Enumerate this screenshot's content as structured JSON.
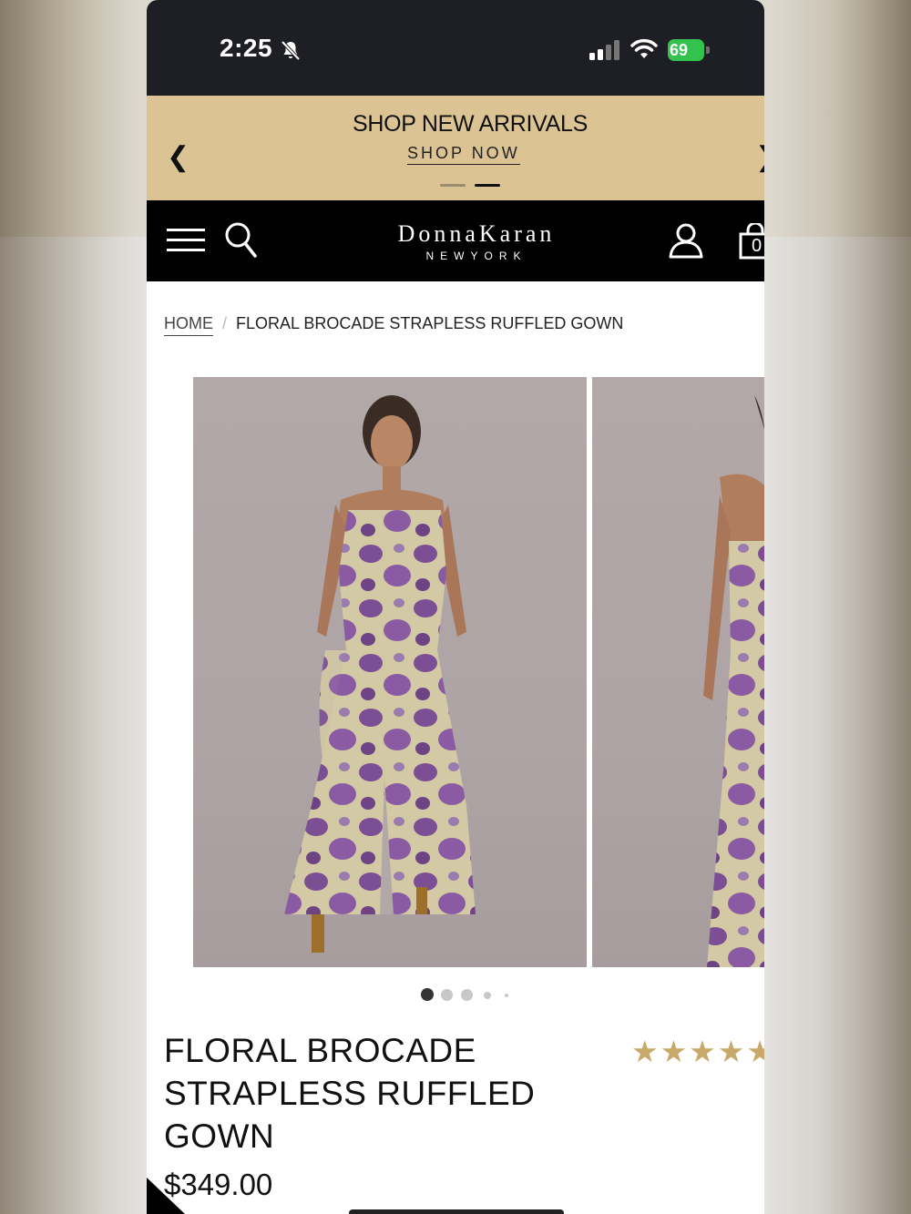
{
  "status_bar": {
    "time": "2:25",
    "battery": "69"
  },
  "promo": {
    "title": "SHOP NEW ARRIVALS",
    "link": "SHOP NOW",
    "prev": "❮",
    "next": "❯"
  },
  "nav": {
    "logo_main": "DonnaKaran",
    "logo_sub": "NEWYORK",
    "bag_count": "0"
  },
  "breadcrumb": {
    "home": "HOME",
    "separator": "/",
    "current": "FLORAL BROCADE STRAPLESS RUFFLED GOWN"
  },
  "product": {
    "title": "FLORAL BROCADE STRAPLESS RUFFLED GOWN",
    "price": "$349.00",
    "rating_stars": "★★★★★",
    "rating": 4.5,
    "image_count": 5,
    "active_image": 1
  },
  "colors": {
    "promo_bg": "#dcc394",
    "nav_bg": "#000000",
    "star": "#c8a96a",
    "dress_purple": "#7c4f94"
  }
}
